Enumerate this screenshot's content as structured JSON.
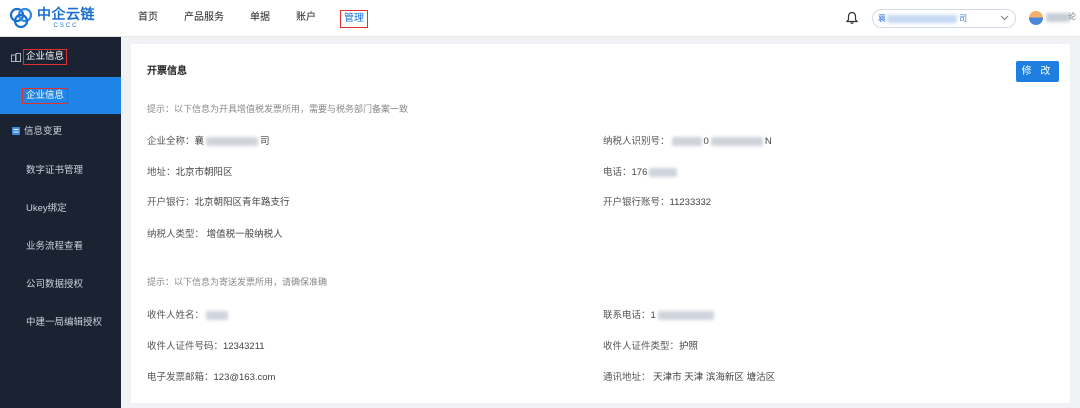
{
  "brand": {
    "name_cn": "中企云链",
    "name_en": "CSCC",
    "color": "#1a6fd0"
  },
  "topnav": [
    {
      "label": "首页",
      "active": false
    },
    {
      "label": "产品服务",
      "active": false
    },
    {
      "label": "单据",
      "active": false
    },
    {
      "label": "账户",
      "active": false
    },
    {
      "label": "管理",
      "active": true
    }
  ],
  "header": {
    "company_prefix": "襄",
    "company_suffix": "司",
    "user_tail": "论"
  },
  "sidebar": {
    "group_label": "企业信息",
    "active_item": "企业信息",
    "items": [
      {
        "label": "信息变更",
        "icon": "list-icon"
      },
      {
        "label": "数字证书管理"
      },
      {
        "label": "Ukey绑定"
      },
      {
        "label": "业务流程查看"
      },
      {
        "label": "公司数据授权"
      },
      {
        "label": "中建一局编辑授权"
      }
    ]
  },
  "invoice": {
    "title": "开票信息",
    "edit_button": "修 改",
    "hint1": "提示：以下信息为开具增值税发票所用，需要与税务部门备案一致",
    "company_name_label": "企业全称：",
    "company_name_prefix": "襄",
    "company_name_suffix": "司",
    "tax_id_label": "纳税人识别号：",
    "tax_id_mid": "0",
    "tax_id_suffix": "N",
    "address_label": "地址：",
    "address_value": "北京市朝阳区",
    "phone_label": "电话：",
    "phone_prefix": "176",
    "bank_label": "开户银行：",
    "bank_value": "北京朝阳区青年路支行",
    "account_label": "开户银行账号：",
    "account_value": "11233332",
    "taxpayer_type_label": "纳税人类型：",
    "taxpayer_type_value": "增值税一般纳税人",
    "hint2": "提示：以下信息为寄送发票所用，请确保准确",
    "recipient_name_label": "收件人姓名：",
    "contact_phone_label": "联系电话：",
    "contact_phone_prefix": "1",
    "id_number_label": "收件人证件号码：",
    "id_number_value": "12343211",
    "id_type_label": "收件人证件类型：",
    "id_type_value": "护照",
    "email_label": "电子发票邮箱：",
    "email_value": "123@163.com",
    "mail_address_label": "通讯地址：",
    "mail_address_value": "天津市 天津 滨海新区 塘沽区"
  }
}
